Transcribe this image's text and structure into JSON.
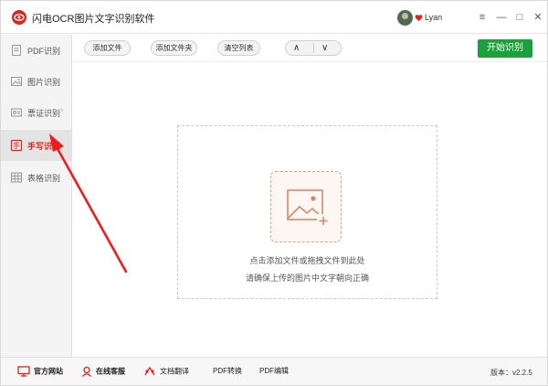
{
  "titlebar": {
    "title": "闪电OCR图片文字识别软件",
    "username": "Lyan",
    "menu_icon": "≡",
    "min_icon": "—",
    "max_icon": "□",
    "close_icon": "✕"
  },
  "sidebar": {
    "items": [
      {
        "label": "PDF识别",
        "icon": "pdf-icon"
      },
      {
        "label": "图片识别",
        "icon": "image-icon"
      },
      {
        "label": "票证识别",
        "icon": "ticket-icon",
        "chevron": "›"
      },
      {
        "label": "手写识别",
        "icon": "handwriting-icon",
        "active": true
      },
      {
        "label": "表格识别",
        "icon": "table-icon"
      }
    ]
  },
  "toolbar": {
    "add_file": "添加文件",
    "add_folder": "添加文件夹",
    "clear_list": "清空列表",
    "up": "∧",
    "down": "∨",
    "start": "开始识别"
  },
  "dropzone": {
    "line1": "点击添加文件或拖拽文件到此处",
    "line2": "请确保上传的图片中文字朝向正确"
  },
  "statusbar": {
    "website": "官方网站",
    "support": "在线客服",
    "translate": "文档翻译",
    "pdf_convert": "PDF转换",
    "pdf_edit": "PDF编辑",
    "version": "版本：v2.2.5"
  },
  "colors": {
    "brand_red": "#e2231a",
    "start_green": "#1aa13a",
    "annotation_red": "#f01c1c"
  }
}
